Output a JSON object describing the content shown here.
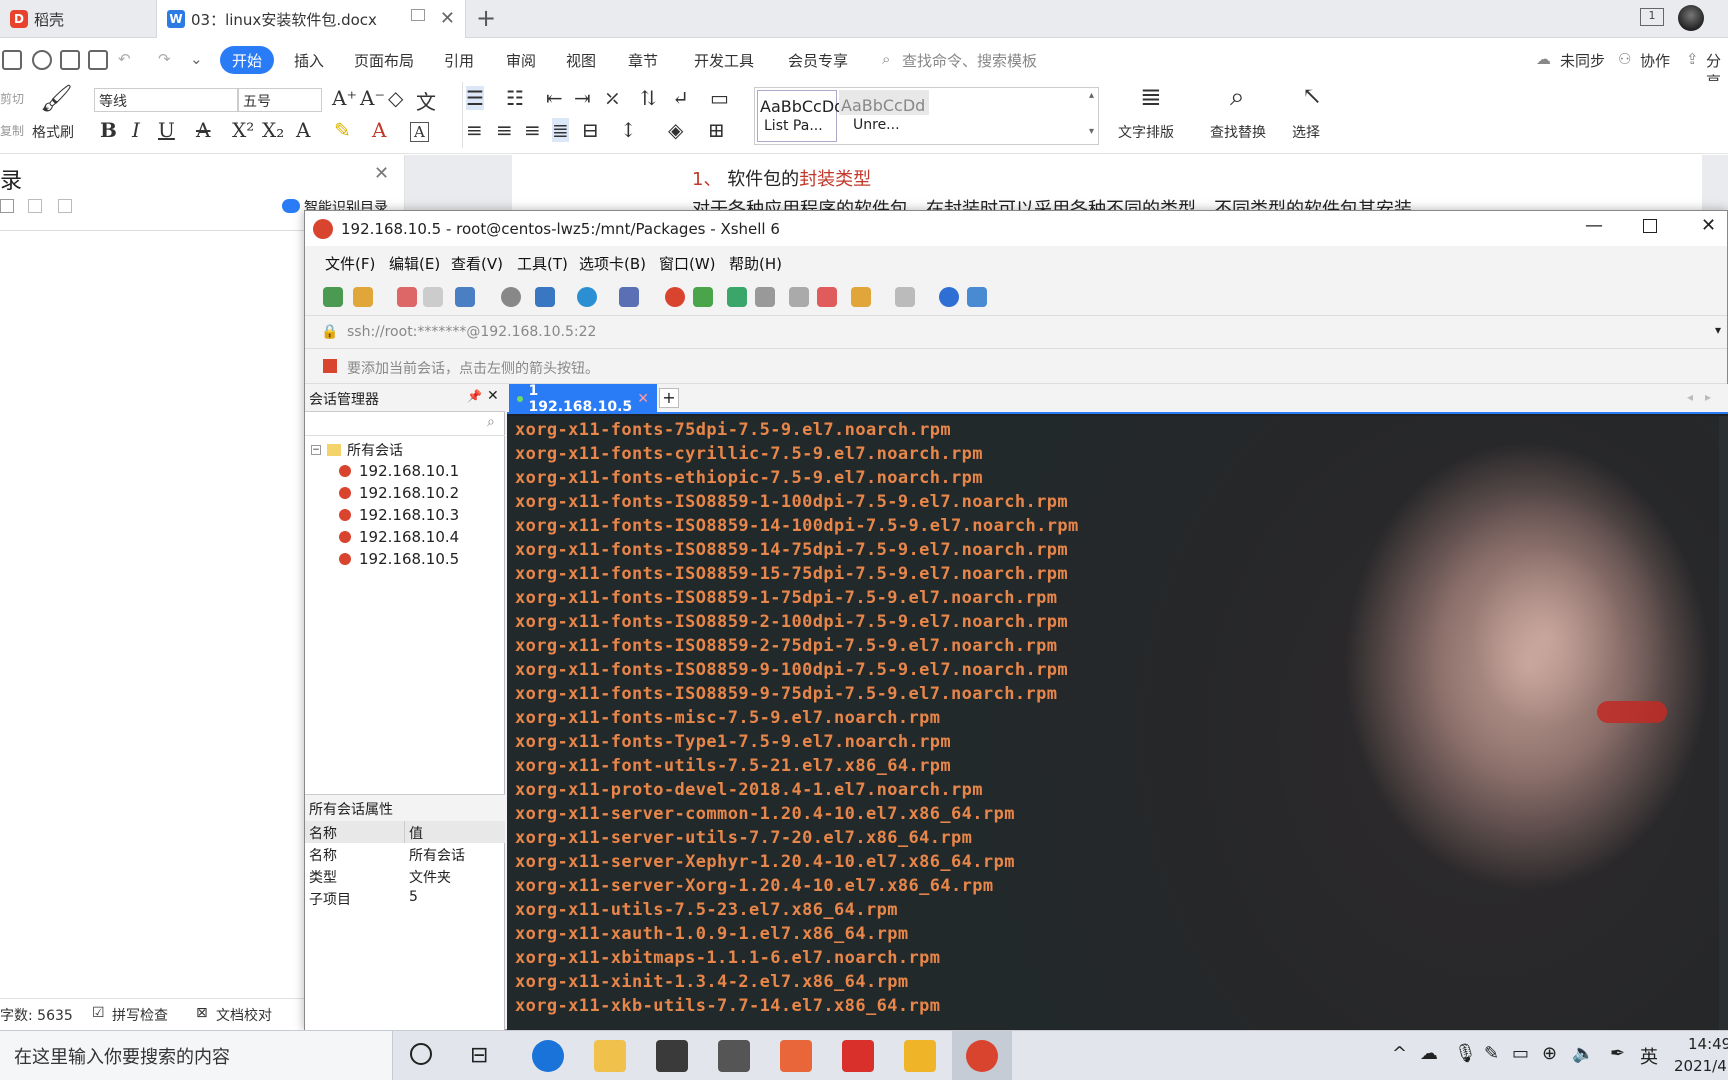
{
  "wps": {
    "tabs": [
      {
        "label": "稻壳"
      },
      {
        "label": "03：linux安装软件包.docx"
      }
    ],
    "menu": [
      "开始",
      "插入",
      "页面布局",
      "引用",
      "审阅",
      "视图",
      "章节",
      "开发工具",
      "会员专享"
    ],
    "search_placeholder": "查找命令、搜索模板",
    "right_actions": [
      "未同步",
      "协作",
      "分享"
    ],
    "ribbon": {
      "cut": "剪切",
      "copy": "复制",
      "format_painter": "格式刷",
      "font_name": "等线",
      "font_size": "五号",
      "style1_preview": "AaBbCcDd",
      "style1_name": "List Pa...",
      "style2_preview": "AaBbCcDd",
      "style2_name": "Unre...",
      "text_layout": "文字排版",
      "find_replace": "查找替换",
      "select": "选择"
    },
    "nav": {
      "title": "录",
      "smart_toc": "智能识别目录"
    },
    "doc": {
      "heading_num": "1、",
      "heading_plain": "软件包的",
      "heading_red": "封装类型",
      "line2": "对于各种应用程序的软件包，在封装时可以采用各种不同的类型，不同类型的软件包其安装"
    },
    "status": {
      "word_count": "字数: 5635",
      "spell_check": "拼写检查",
      "doc_check": "文档校对"
    }
  },
  "xshell": {
    "title": "192.168.10.5 - root@centos-lwz5:/mnt/Packages - Xshell 6",
    "menu": [
      "文件(F)",
      "编辑(E)",
      "查看(V)",
      "工具(T)",
      "选项卡(B)",
      "窗口(W)",
      "帮助(H)"
    ],
    "address": "ssh://root:*******@192.168.10.5:22",
    "hint": "要添加当前会话，点击左侧的箭头按钮。",
    "session_manager": "会话管理器",
    "tree_root": "所有会话",
    "sessions": [
      "192.168.10.1",
      "192.168.10.2",
      "192.168.10.3",
      "192.168.10.4",
      "192.168.10.5"
    ],
    "props_title": "所有会话属性",
    "props_headers": [
      "名称",
      "值"
    ],
    "props_rows": [
      {
        "k": "名称",
        "v": "所有会话"
      },
      {
        "k": "类型",
        "v": "文件夹"
      },
      {
        "k": "子项目",
        "v": "5"
      }
    ],
    "tab_label": "1 192.168.10.5",
    "terminal_lines": [
      "xorg-x11-fonts-75dpi-7.5-9.el7.noarch.rpm",
      "xorg-x11-fonts-cyrillic-7.5-9.el7.noarch.rpm",
      "xorg-x11-fonts-ethiopic-7.5-9.el7.noarch.rpm",
      "xorg-x11-fonts-ISO8859-1-100dpi-7.5-9.el7.noarch.rpm",
      "xorg-x11-fonts-ISO8859-14-100dpi-7.5-9.el7.noarch.rpm",
      "xorg-x11-fonts-ISO8859-14-75dpi-7.5-9.el7.noarch.rpm",
      "xorg-x11-fonts-ISO8859-15-75dpi-7.5-9.el7.noarch.rpm",
      "xorg-x11-fonts-ISO8859-1-75dpi-7.5-9.el7.noarch.rpm",
      "xorg-x11-fonts-ISO8859-2-100dpi-7.5-9.el7.noarch.rpm",
      "xorg-x11-fonts-ISO8859-2-75dpi-7.5-9.el7.noarch.rpm",
      "xorg-x11-fonts-ISO8859-9-100dpi-7.5-9.el7.noarch.rpm",
      "xorg-x11-fonts-ISO8859-9-75dpi-7.5-9.el7.noarch.rpm",
      "xorg-x11-fonts-misc-7.5-9.el7.noarch.rpm",
      "xorg-x11-fonts-Type1-7.5-9.el7.noarch.rpm",
      "xorg-x11-font-utils-7.5-21.el7.x86_64.rpm",
      "xorg-x11-proto-devel-2018.4-1.el7.noarch.rpm",
      "xorg-x11-server-common-1.20.4-10.el7.x86_64.rpm",
      "xorg-x11-server-utils-7.7-20.el7.x86_64.rpm",
      "xorg-x11-server-Xephyr-1.20.4-10.el7.x86_64.rpm",
      "xorg-x11-server-Xorg-1.20.4-10.el7.x86_64.rpm",
      "xorg-x11-utils-7.5-23.el7.x86_64.rpm",
      "xorg-x11-xauth-1.0.9-1.el7.x86_64.rpm",
      "xorg-x11-xbitmaps-1.1.1-6.el7.noarch.rpm",
      "xorg-x11-xinit-1.3.4-2.el7.x86_64.rpm",
      "xorg-x11-xkb-utils-7.7-14.el7.x86_64.rpm"
    ]
  },
  "taskbar": {
    "search_placeholder": "在这里输入你要搜索的内容",
    "ime": "英",
    "time": "14:49",
    "date": "2021/4"
  },
  "colors": {
    "accent": "#2a7cf6",
    "terminal_text": "#e8864a",
    "doc_red": "#c0392b"
  }
}
